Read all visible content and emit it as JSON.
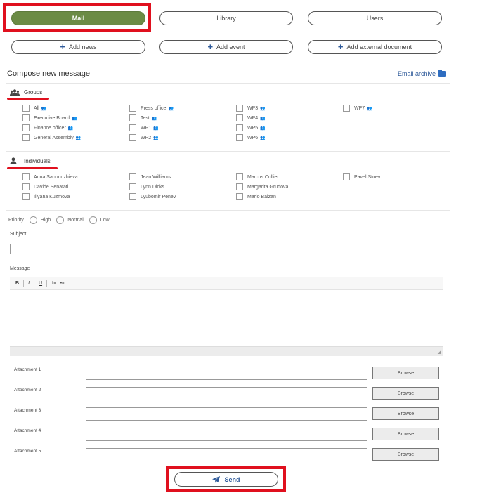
{
  "nav": {
    "mail": "Mail",
    "library": "Library",
    "users": "Users"
  },
  "actions": {
    "add_news": "Add news",
    "add_event": "Add event",
    "add_document": "Add external document"
  },
  "compose": {
    "title": "Compose new message",
    "archive": "Email archive"
  },
  "groups": {
    "title": "Groups",
    "items": [
      "All",
      "Executive Board",
      "Finance officer",
      "General Assembly",
      "Press office",
      "Test",
      "WP1",
      "WP2",
      "WP3",
      "WP4",
      "WP5",
      "WP6",
      "WP7"
    ]
  },
  "individuals": {
    "title": "Individuals",
    "items": [
      "Anna Sapundzhieva",
      "Davide Senatati",
      "Iliyana Kuzmova",
      "Jean Williams",
      "Lynn Dicks",
      "Lyubomir Penev",
      "Marcus Collier",
      "Margarita Grudova",
      "Mario Balzan",
      "Pavel Stoev"
    ]
  },
  "priority": {
    "label": "Priority",
    "options": [
      "High",
      "Normal",
      "Low"
    ]
  },
  "form": {
    "subject_label": "Subject",
    "message_label": "Message",
    "toolbar": [
      "B",
      "I",
      "U",
      "1=",
      "•="
    ],
    "attachments": [
      "Attachment 1",
      "Attachment 2",
      "Attachment 3",
      "Attachment 4",
      "Attachment 5"
    ],
    "browse": "Browse",
    "send": "Send"
  },
  "colors": {
    "accent_green": "#6b8b45",
    "highlight_red": "#e0101e",
    "link_blue": "#2e5a9a"
  }
}
